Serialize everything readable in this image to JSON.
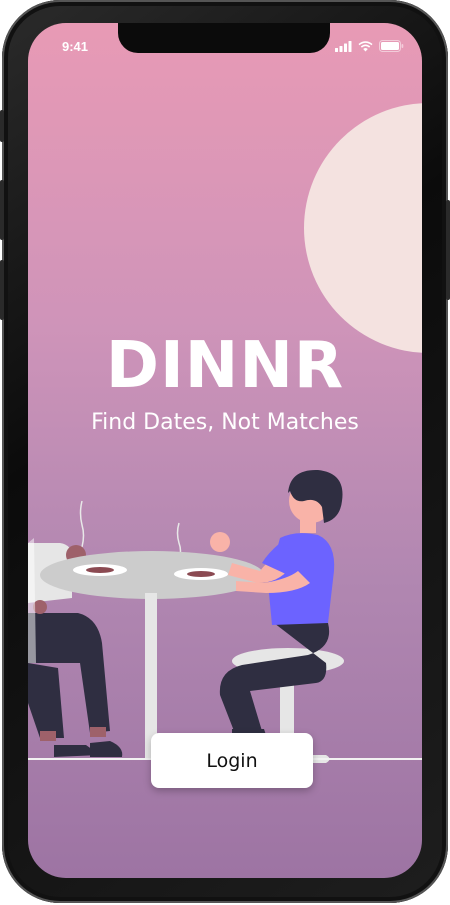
{
  "status_bar": {
    "time": "9:41"
  },
  "app": {
    "title": "DINNR",
    "tagline": "Find Dates, Not Matches",
    "login_label": "Login"
  },
  "colors": {
    "gradient_top": "#e89ab5",
    "gradient_bottom": "#9d74a3",
    "moon": "#f4e2e0",
    "shirt": "#6c63ff",
    "skin": "#f9b3a8",
    "pants": "#2f2e41",
    "table": "#cccccc"
  },
  "icons": [
    "signal-icon",
    "wifi-icon",
    "battery-icon"
  ]
}
